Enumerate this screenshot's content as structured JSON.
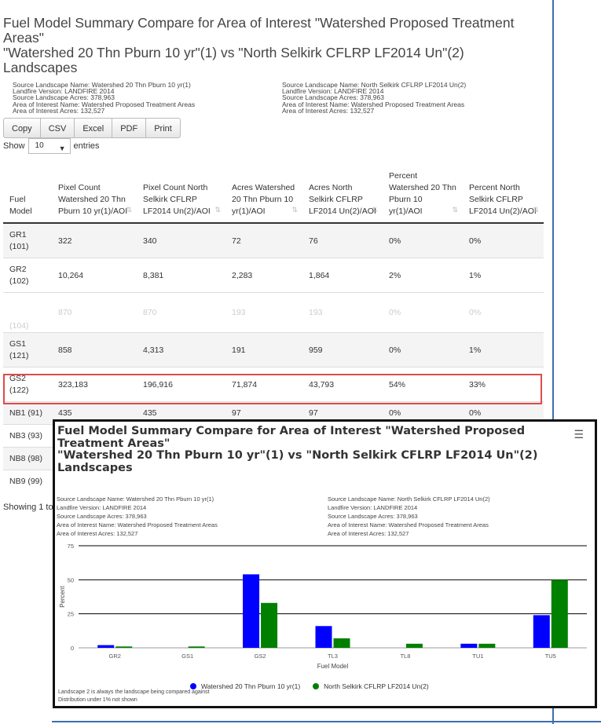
{
  "page_title": {
    "line1": "Fuel Model Summary Compare for Area of Interest \"Watershed Proposed Treatment",
    "line2": "Areas\"",
    "line3": "\"Watershed 20 Thn Pburn 10 yr\"(1) vs \"North Selkirk CFLRP LF2014 Un\"(2)",
    "line4": "Landscapes"
  },
  "meta_left": [
    "Source Landscape Name: Watershed 20 Thn Pburn 10 yr(1)",
    "Landfire Version: LANDFIRE 2014",
    "Source Landscape Acres: 378,963",
    "Area of Interest Name: Watershed Proposed Treatment Areas",
    "Area of Interest Acres: 132,527"
  ],
  "meta_right": [
    "Source Landscape Name: North Selkirk CFLRP LF2014 Un(2)",
    "Landfire Version: LANDFIRE 2014",
    "Source Landscape Acres: 378,963",
    "Area of Interest Name: Watershed Proposed Treatment Areas",
    "Area of Interest Acres: 132,527"
  ],
  "buttons": [
    "Copy",
    "CSV",
    "Excel",
    "PDF",
    "Print"
  ],
  "show_entries": {
    "prefix": "Show",
    "value": "10",
    "suffix": "entries"
  },
  "table": {
    "headers": [
      "Fuel Model",
      "Pixel Count Watershed 20 Thn Pburn 10 yr(1)/AOI",
      "Pixel Count North Selkirk CFLRP LF2014 Un(2)/AOI",
      "Acres Watershed 20 Thn Pburn 10 yr(1)/AOI",
      "Acres North Selkirk CFLRP LF2014 Un(2)/AOI",
      "Percent Watershed 20 Thn Pburn 10 yr(1)/AOI",
      "Percent North Selkirk CFLRP LF2014 Un(2)/AOI"
    ],
    "rows": [
      [
        "GR1 (101)",
        "322",
        "340",
        "72",
        "76",
        "0%",
        "0%"
      ],
      [
        "GR2 (102)",
        "10,264",
        "8,381",
        "2,283",
        "1,864",
        "2%",
        "1%"
      ],
      [
        "(104)",
        "870",
        "870",
        "193",
        "193",
        "0%",
        "0%"
      ],
      [
        "GS1 (121)",
        "858",
        "4,313",
        "191",
        "959",
        "0%",
        "1%"
      ],
      [
        "GS2 (122)",
        "323,183",
        "196,916",
        "71,874",
        "43,793",
        "54%",
        "33%"
      ],
      [
        "NB1 (91)",
        "435",
        "435",
        "97",
        "97",
        "0%",
        "0%"
      ],
      [
        "NB3 (93)",
        "",
        "",
        "",
        "",
        "",
        ""
      ],
      [
        "NB8 (98)",
        "",
        "",
        "",
        "",
        "",
        ""
      ],
      [
        "NB9 (99)",
        "",
        "",
        "",
        "",
        "",
        ""
      ]
    ]
  },
  "showing_text": "Showing 1 to",
  "chart_panel": {
    "title_line1": "Fuel Model Summary Compare for Area of Interest \"Watershed Proposed",
    "title_line2": "Treatment Areas\"",
    "title_line3": "\"Watershed 20 Thn Pburn 10 yr\"(1) vs \"North Selkirk CFLRP LF2014 Un\"(2)",
    "title_line4": "Landscapes",
    "menu_icon": "hamburger-menu-icon",
    "footnote1": "Landscape 2 is always the landscape being compared against",
    "footnote2": "Distribution under 1% not shown"
  },
  "chart_data": {
    "type": "bar",
    "categories": [
      "GR2",
      "GS1",
      "GS2",
      "TL3",
      "TL8",
      "TU1",
      "TU5"
    ],
    "series": [
      {
        "name": "Watershed 20 Thn Pburn 10 yr(1)",
        "color": "#0000ff",
        "values": [
          2,
          0,
          54,
          16,
          0,
          3,
          24
        ]
      },
      {
        "name": "North Selkirk CFLRP LF2014 Un(2)",
        "color": "#008000",
        "values": [
          1,
          1,
          33,
          7,
          3,
          3,
          50
        ]
      }
    ],
    "xlabel": "Fuel Model",
    "ylabel": "Percent",
    "ylim": [
      0,
      75
    ],
    "yticks": [
      "0",
      "25",
      "50",
      "75"
    ],
    "grid": true,
    "legend": "bottom-center"
  }
}
